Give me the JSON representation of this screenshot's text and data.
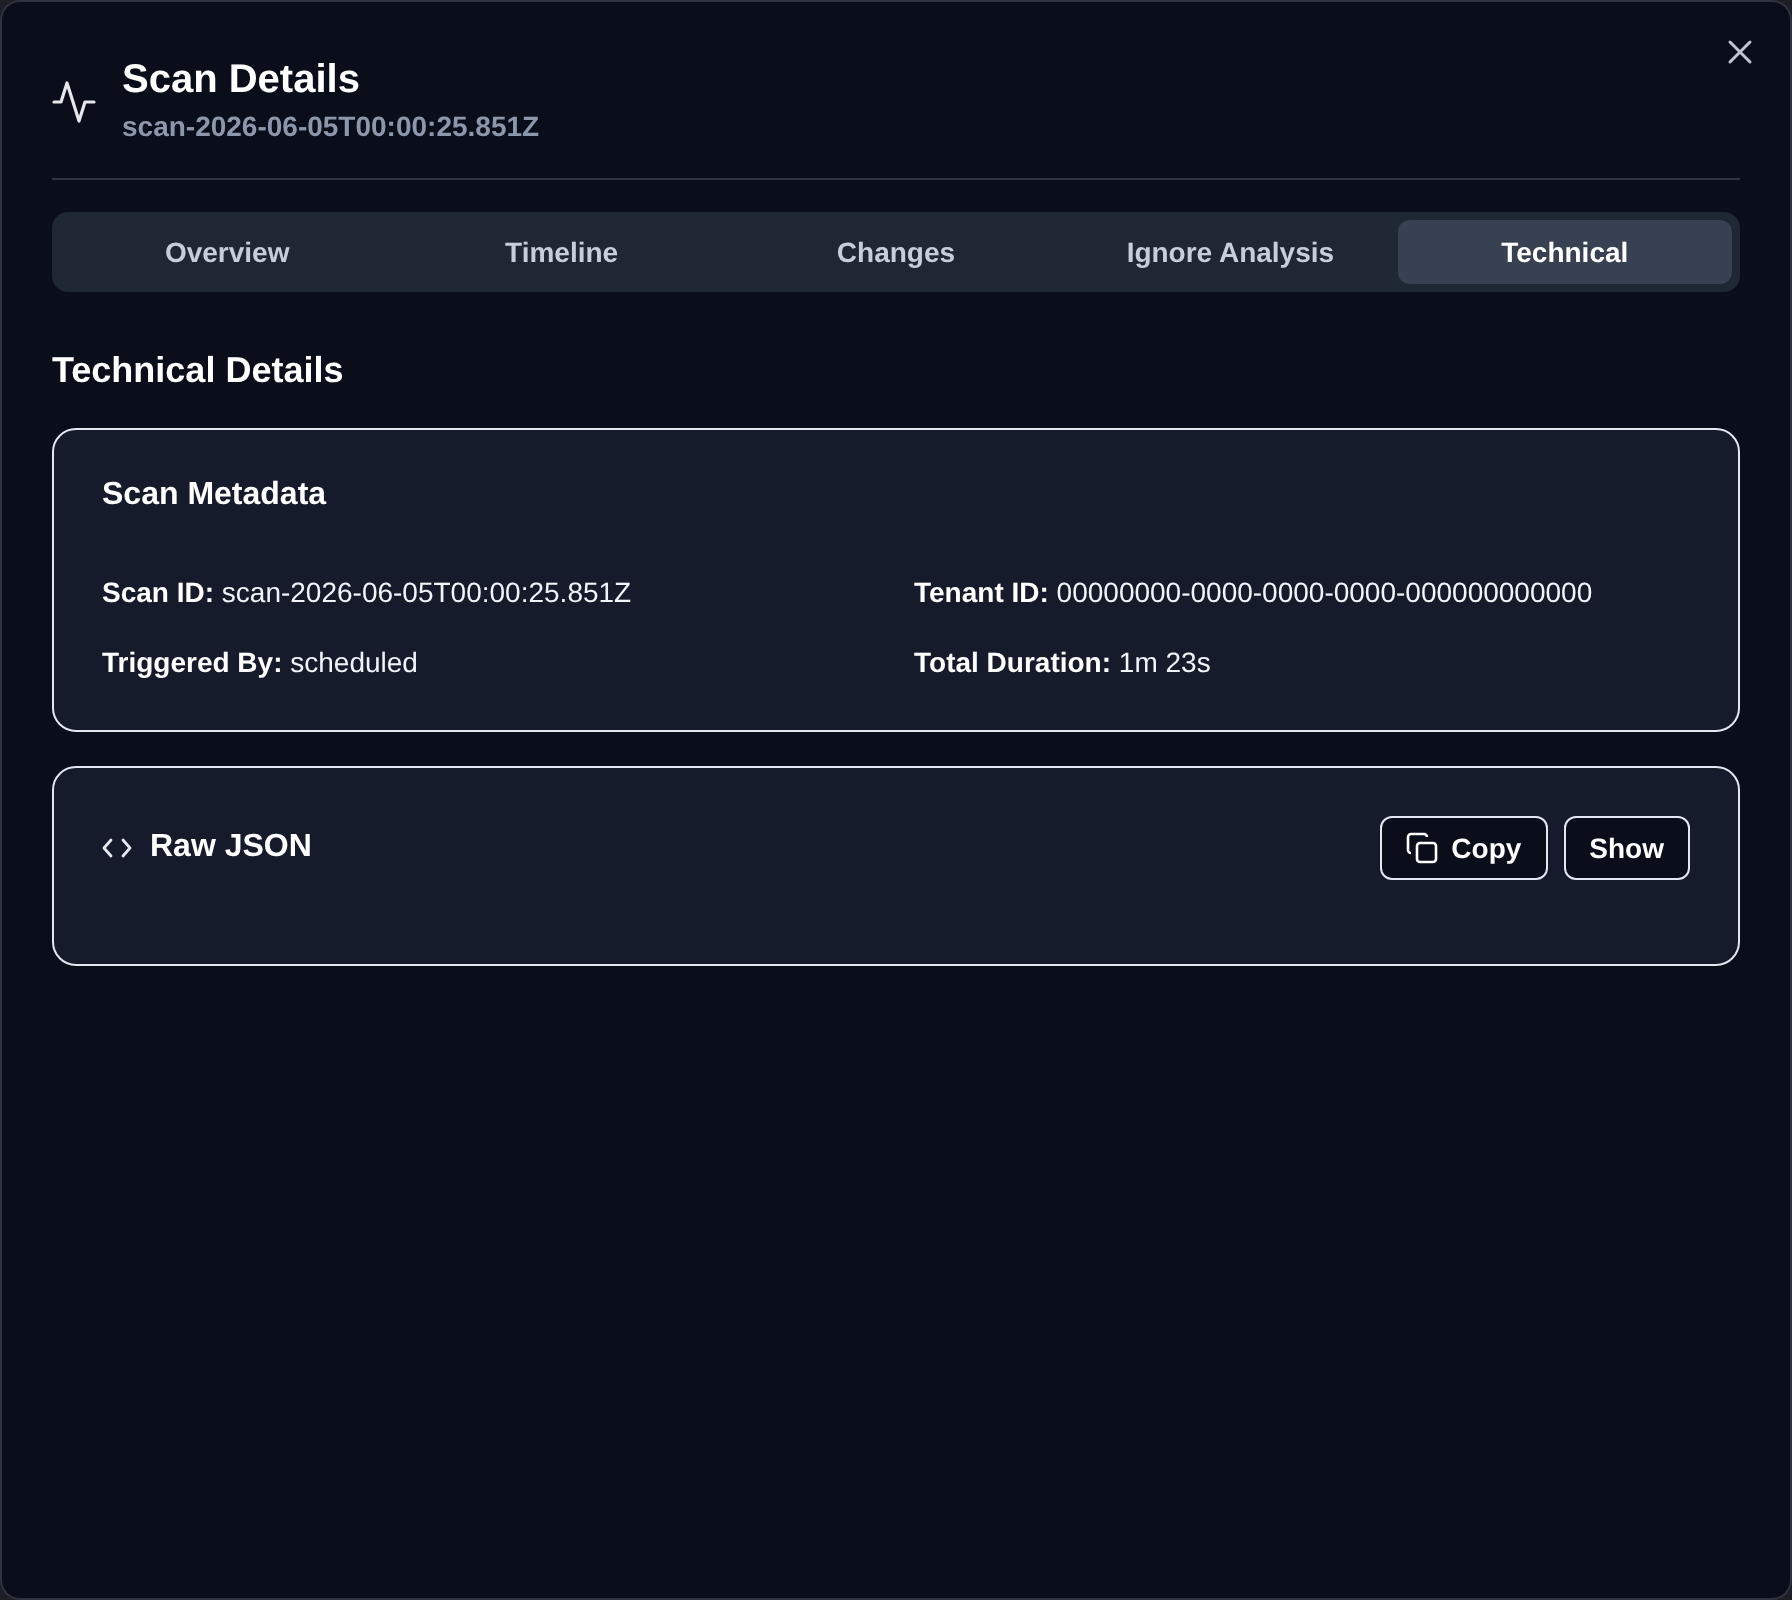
{
  "dialog": {
    "title": "Scan Details",
    "subtitle": "scan-2026-06-05T00:00:25.851Z"
  },
  "tabs": [
    {
      "label": "Overview",
      "selected": false
    },
    {
      "label": "Timeline",
      "selected": false
    },
    {
      "label": "Changes",
      "selected": false
    },
    {
      "label": "Ignore Analysis",
      "selected": false
    },
    {
      "label": "Technical",
      "selected": true
    }
  ],
  "section_title": "Technical Details",
  "metadata_card": {
    "title": "Scan Metadata",
    "fields": [
      {
        "label": "Scan ID:",
        "value": "scan-2026-06-05T00:00:25.851Z"
      },
      {
        "label": "Tenant ID:",
        "value": "00000000-0000-0000-0000-000000000000"
      },
      {
        "label": "Triggered By:",
        "value": "scheduled"
      },
      {
        "label": "Total Duration:",
        "value": "1m 23s"
      }
    ]
  },
  "raw_json_card": {
    "title": "Raw JSON",
    "buttons": [
      {
        "label": "Copy",
        "kind": "copy"
      },
      {
        "label": "Show",
        "kind": "plain"
      }
    ]
  }
}
